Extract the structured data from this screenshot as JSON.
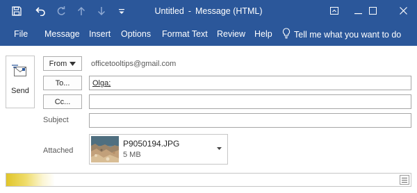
{
  "window": {
    "title_part1": "Untitled",
    "title_separator": "-",
    "title_part2": "Message (HTML)",
    "accent_color": "#2b579a"
  },
  "qat": {
    "icons": [
      "save-icon",
      "undo-icon",
      "redo-icon",
      "up-arrow-icon",
      "down-arrow-icon",
      "customize-qat-icon"
    ]
  },
  "window_controls": {
    "icons": [
      "ribbon-display-options-icon",
      "minimize-icon",
      "restore-icon",
      "close-icon"
    ]
  },
  "menu": {
    "file": "File",
    "message": "Message",
    "insert": "Insert",
    "options": "Options",
    "format_text": "Format Text",
    "review": "Review",
    "help": "Help",
    "tell_me": "Tell me what you want to do"
  },
  "compose": {
    "send_label": "Send",
    "from_button": "From",
    "from_value": "officetooltips@gmail.com",
    "to_button": "To...",
    "to_value": "Olga;",
    "cc_button": "Cc...",
    "cc_value": "",
    "subject_label": "Subject",
    "subject_value": "",
    "attached_label": "Attached"
  },
  "attachment": {
    "name": "P9050194.JPG",
    "size": "5 MB"
  }
}
